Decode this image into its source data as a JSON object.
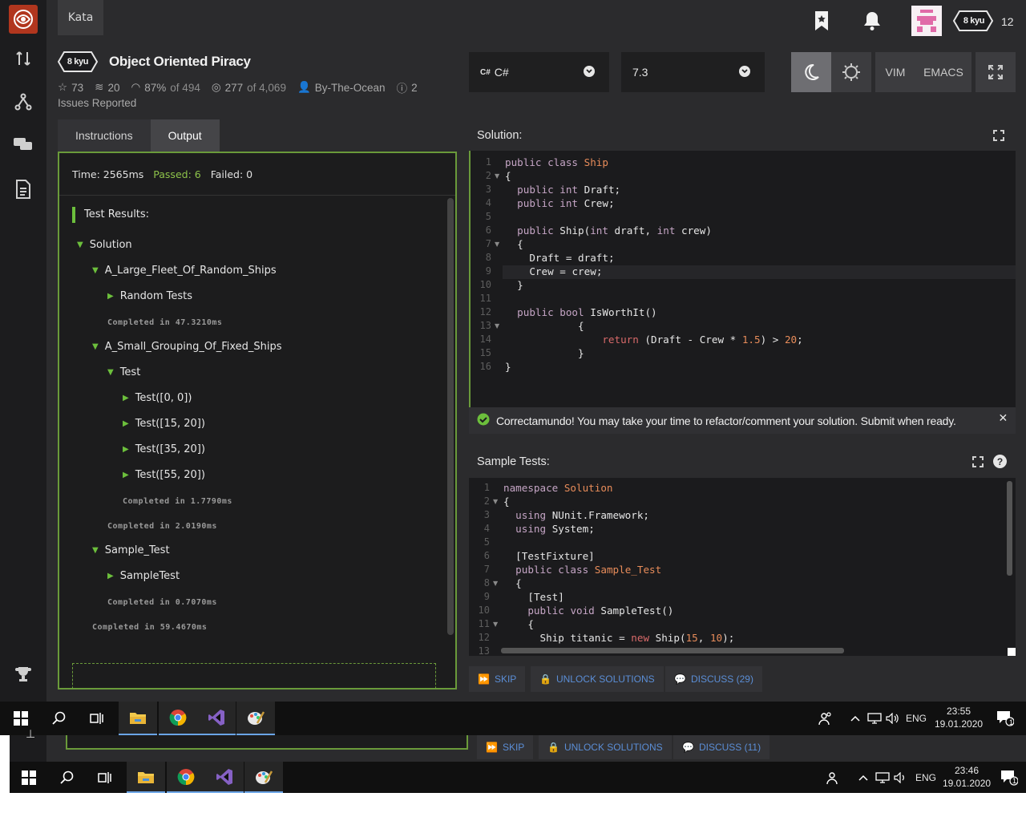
{
  "header": {
    "kata_tab": "Kata",
    "rank": "8 kyu",
    "honor": "12"
  },
  "kata": {
    "rank": "8 kyu",
    "title": "Object Oriented Piracy",
    "stars": "73",
    "collections": "20",
    "satisfaction": "87%",
    "satisfaction_of": "of 494",
    "completed": "277",
    "completed_of": "of 4,069",
    "author": "By-The-Ocean",
    "issues_count": "2",
    "issues_label": "Issues Reported"
  },
  "editor_controls": {
    "language": "C#",
    "version": "7.3",
    "vim": "VIM",
    "emacs": "EMACS"
  },
  "tabs": [
    {
      "label": "Instructions",
      "active": false
    },
    {
      "label": "Output",
      "active": true
    }
  ],
  "output": {
    "time": "Time: 2565ms",
    "passed": "Passed: 6",
    "failed": "Failed: 0",
    "results_title": "Test Results:",
    "items": [
      {
        "text": "Solution"
      },
      {
        "text": "A_Large_Fleet_Of_Random_Ships"
      },
      {
        "text": "Random Tests"
      },
      {
        "text": "Completed in 47.3210ms"
      },
      {
        "text": "A_Small_Grouping_Of_Fixed_Ships"
      },
      {
        "text": "Test"
      },
      {
        "text": "Test([0, 0])"
      },
      {
        "text": "Test([15, 20])"
      },
      {
        "text": "Test([35, 20])"
      },
      {
        "text": "Test([55, 20])"
      },
      {
        "text": "Completed in 1.7790ms"
      },
      {
        "text": "Completed in 2.0190ms"
      },
      {
        "text": "Sample_Test"
      },
      {
        "text": "SampleTest"
      },
      {
        "text": "Completed in 0.7070ms"
      },
      {
        "text": "Completed in 59.4670ms"
      }
    ]
  },
  "solution": {
    "title": "Solution:",
    "line_numbers": [
      "1",
      "2",
      "3",
      "4",
      "5",
      "6",
      "7",
      "8",
      "9",
      "10",
      "11",
      "12",
      "13",
      "14",
      "15",
      "16"
    ],
    "lines": [
      "public class Ship",
      "{",
      "  public int Draft;",
      "  public int Crew;",
      "",
      "  public Ship(int draft, int crew)",
      "  {",
      "    Draft = draft;",
      "    Crew = crew;",
      "  }",
      "",
      "  public bool IsWorthIt()",
      "            {",
      "                return (Draft - Crew * 1.5) > 20;",
      "            }",
      "}"
    ]
  },
  "notice": "Correctamundo! You may take your time to refactor/comment your solution. Submit when ready.",
  "sample_tests": {
    "title": "Sample Tests:",
    "line_numbers": [
      "1",
      "2",
      "3",
      "4",
      "5",
      "6",
      "7",
      "8",
      "9",
      "10",
      "11",
      "12",
      "13"
    ],
    "lines": [
      "namespace Solution",
      "{",
      "  using NUnit.Framework;",
      "  using System;",
      "",
      "  [TestFixture]",
      "  public class Sample_Test",
      "  {",
      "    [Test]",
      "    public void SampleTest()",
      "    {",
      "      Ship titanic = new Ship(15, 10);",
      ""
    ]
  },
  "actions": {
    "skip": "SKIP",
    "unlock": "UNLOCK SOLUTIONS",
    "discuss": "DISCUSS (29)"
  },
  "actions_behind": {
    "skip": "SKIP",
    "unlock": "UNLOCK SOLUTIONS",
    "discuss": "DISCUSS (11)"
  },
  "taskbar_front": {
    "lang": "ENG",
    "time": "23:55",
    "date": "19.01.2020",
    "notif": "1"
  },
  "taskbar_back": {
    "lang": "ENG",
    "time": "23:46",
    "date": "19.01.2020",
    "notif": "1"
  },
  "colors": {
    "accent_green": "#6cbf3c",
    "logo_red": "#b1361e",
    "link_blue": "#5b8ed6"
  }
}
